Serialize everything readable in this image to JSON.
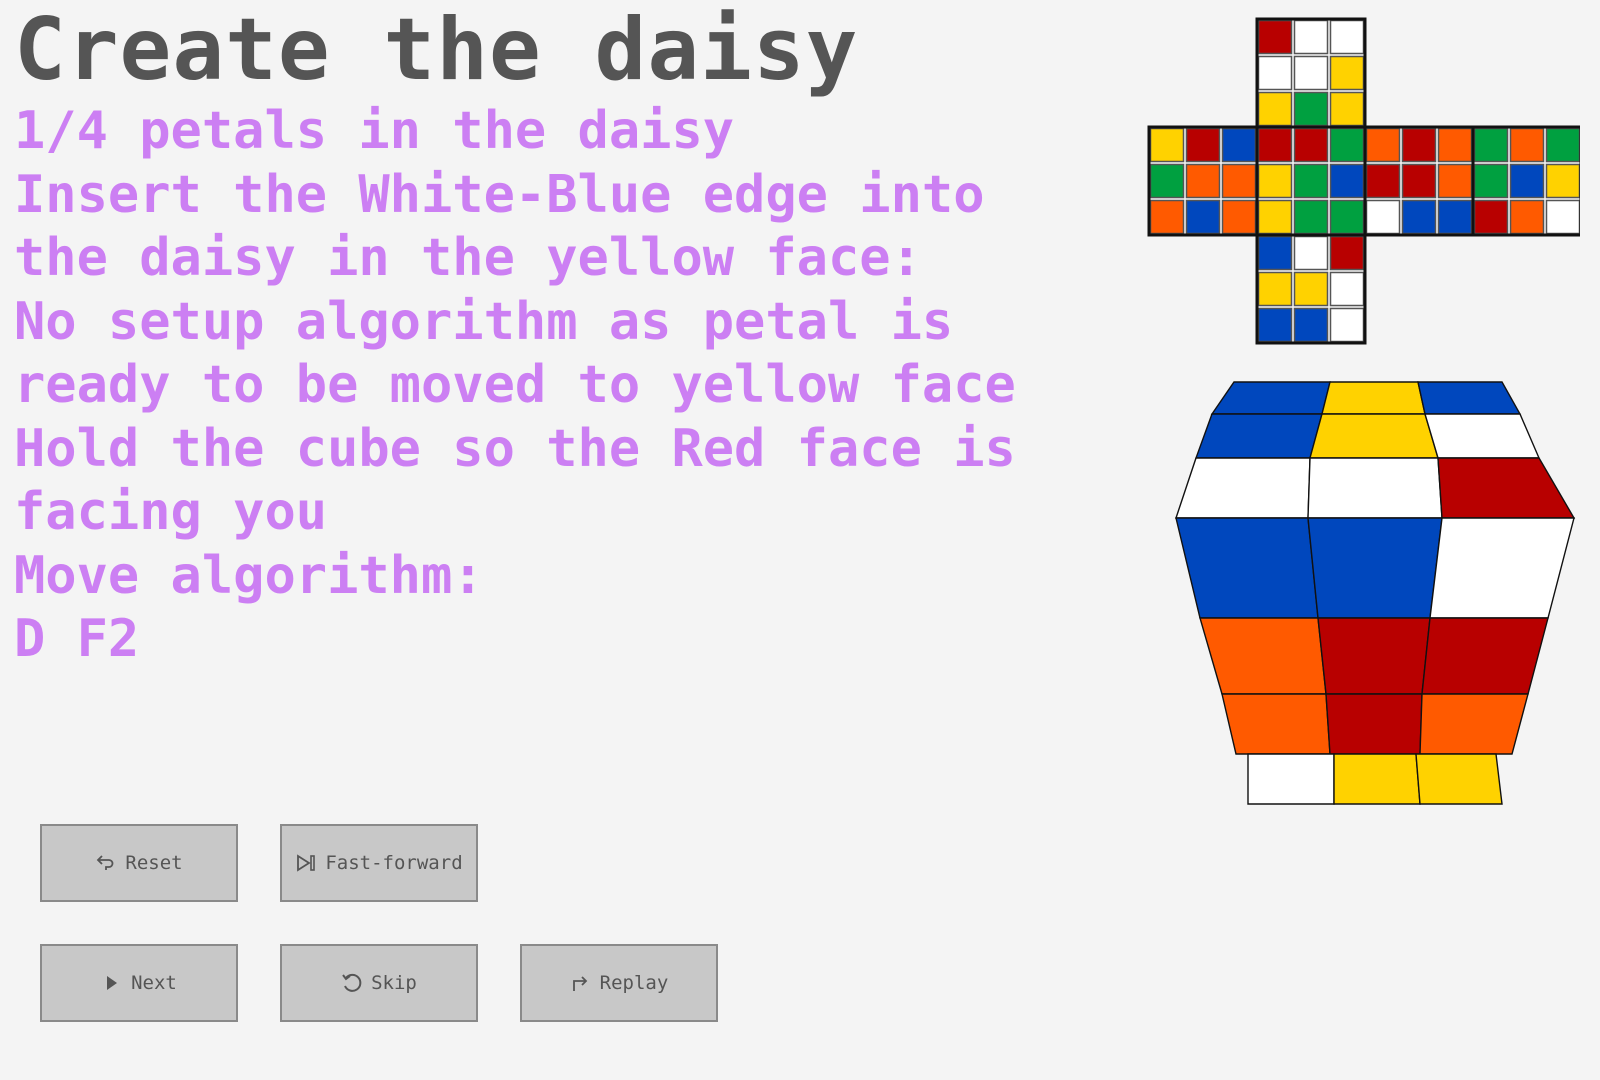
{
  "title": "Create the daisy",
  "instructions": [
    "1/4 petals in the daisy",
    "Insert the White-Blue edge into",
    "the daisy in the yellow face:",
    "No setup algorithm as petal is",
    "ready to be moved to yellow face",
    "Hold the cube so the Red face is",
    "facing you",
    "Move algorithm:",
    "D F2"
  ],
  "buttons": {
    "reset": "Reset",
    "fast_forward": "Fast-forward",
    "next": "Next",
    "skip": "Skip",
    "replay": "Replay"
  },
  "icons": {
    "reset": "undo-arrow-icon",
    "fast_forward": "skip-forward-icon",
    "next": "play-triangle-icon",
    "skip": "rotate-icon",
    "replay": "share-arrow-icon"
  },
  "colors": {
    "title": "#555555",
    "instructions": "#cc7ff3",
    "background": "#f4f4f4",
    "cube_white": "#ffffff",
    "cube_yellow": "#ffd200",
    "cube_red": "#b80000",
    "cube_orange": "#ff5a00",
    "cube_green": "#00a040",
    "cube_blue": "#0047bd"
  },
  "cube_net": {
    "top": [
      [
        "R",
        "W",
        "W"
      ],
      [
        "W",
        "W",
        "Y"
      ],
      [
        "Y",
        "G",
        "Y"
      ]
    ],
    "middle": [
      [
        "Y",
        "R",
        "B",
        "R",
        "R",
        "G",
        "O",
        "R",
        "O",
        "G",
        "O",
        "G"
      ],
      [
        "G",
        "O",
        "O",
        "Y",
        "G",
        "B",
        "R",
        "R",
        "O",
        "G",
        "B",
        "Y"
      ],
      [
        "O",
        "B",
        "O",
        "Y",
        "G",
        "G",
        "W",
        "B",
        "B",
        "R",
        "O",
        "W"
      ]
    ],
    "bottom": [
      [
        "B",
        "W",
        "R"
      ],
      [
        "Y",
        "Y",
        "W"
      ],
      [
        "B",
        "B",
        "W"
      ]
    ]
  },
  "cube_3d": {
    "top_band": [
      "B",
      "Y",
      "B"
    ],
    "row1": [
      "B",
      "Y",
      "W"
    ],
    "row2": [
      "W",
      "W",
      "R"
    ],
    "row3": [
      "B",
      "B",
      "W"
    ],
    "row4": [
      "O",
      "R",
      "R"
    ],
    "row5": [
      "O",
      "R",
      "O"
    ],
    "bottom_band": [
      "W",
      "Y",
      "Y"
    ]
  }
}
